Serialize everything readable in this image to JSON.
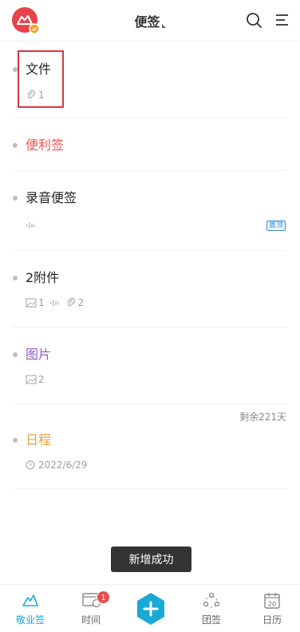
{
  "header": {
    "title": "便签"
  },
  "colors": {
    "accent": "#1aa9d6",
    "red": "#ef5350",
    "purple": "#8e5cc7",
    "orange": "#e6a23c",
    "highlight": "#d9363e"
  },
  "notes": [
    {
      "title": "文件",
      "attachments": "1"
    },
    {
      "title": "便利签"
    },
    {
      "title": "录音便签",
      "pin_label": "置顶"
    },
    {
      "title": "2附件",
      "images": "1",
      "attachments": "2"
    },
    {
      "title": "图片",
      "images": "2"
    },
    {
      "title": "日程",
      "date": "2022/6/29",
      "remaining": "剩余221天"
    }
  ],
  "toast": "新增成功",
  "tabs": [
    {
      "label": "敬业签",
      "active": true
    },
    {
      "label": "时间",
      "badge": "1"
    },
    {
      "label": "团签"
    },
    {
      "label": "日历",
      "day": "20"
    }
  ]
}
